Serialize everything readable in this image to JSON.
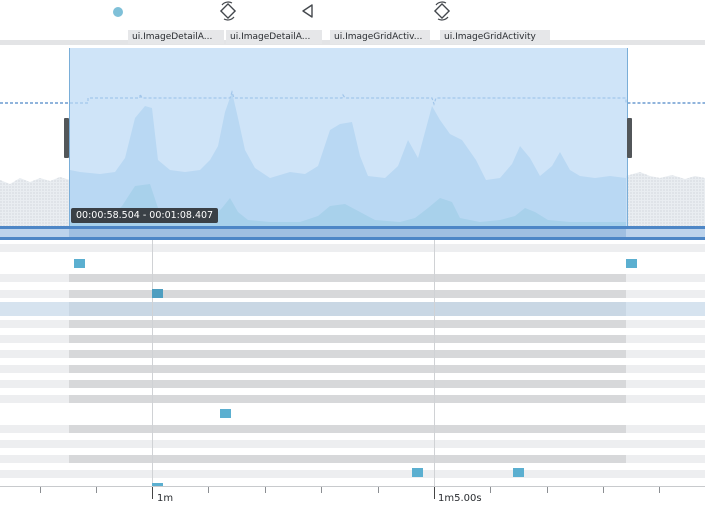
{
  "activity_lane": {
    "events": [
      {
        "icon": "touch-dot-icon"
      },
      {
        "icon": "rotate-icon"
      },
      {
        "icon": "back-triangle-icon"
      },
      {
        "icon": "rotate-icon"
      }
    ],
    "labels": [
      "ui.ImageDetailA...",
      "ui.ImageDetailA...",
      "ui.ImageGridActiv...",
      "ui.ImageGridActivity"
    ]
  },
  "selection": {
    "range_label": "00:00:58.504 - 00:01:08.407"
  },
  "axis": {
    "labels": [
      "1m",
      "1m5.00s"
    ]
  },
  "colors": {
    "selection_fill": "#bfdbf5",
    "range_bar": "#4d86c6",
    "marker": "#5bafd0",
    "series_light": "#a9d0ea",
    "series_dark": "#63b3cc"
  }
}
